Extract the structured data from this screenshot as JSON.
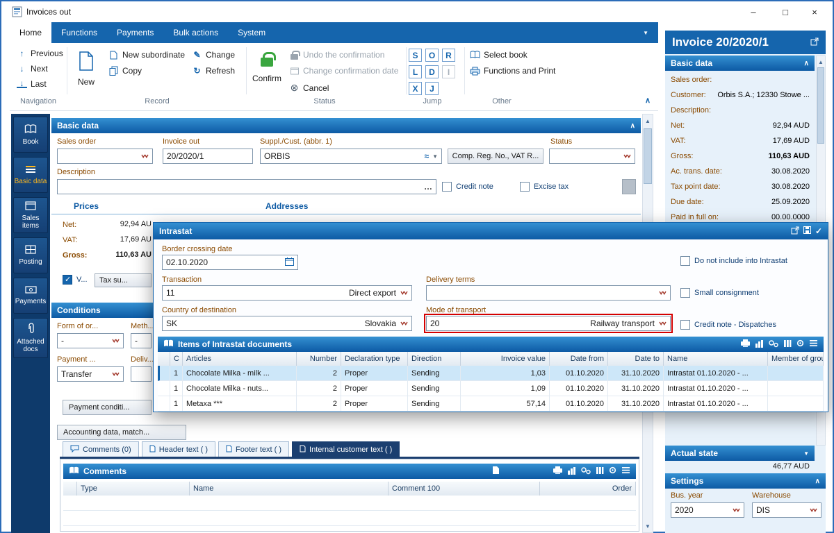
{
  "window": {
    "title": "Invoices out"
  },
  "icons": {
    "minimize": "–",
    "maximize": "□",
    "close": "×",
    "prev": "↑",
    "next": "↓",
    "last": "↓",
    "change": "✎",
    "refresh": "↻",
    "cancel": "⊗",
    "dropdown": "▼",
    "collapse": "∧",
    "check": "✓",
    "dots": "…",
    "supplier": "≈",
    "up": "▲",
    "down": "▼"
  },
  "tabs": [
    {
      "label": "Home"
    },
    {
      "label": "Functions"
    },
    {
      "label": "Payments"
    },
    {
      "label": "Bulk actions"
    },
    {
      "label": "System"
    }
  ],
  "ribbon": {
    "navigation": {
      "label": "Navigation",
      "previous": "Previous",
      "next": "Next",
      "last": "Last"
    },
    "record": {
      "label": "Record",
      "new": "New",
      "new_subordinate": "New subordinate",
      "copy": "Copy",
      "change": "Change",
      "refresh": "Refresh"
    },
    "status": {
      "label": "Status",
      "confirm": "Confirm",
      "undo": "Undo the confirmation",
      "change_date": "Change confirmation date",
      "cancel": "Cancel"
    },
    "jump": {
      "label": "Jump",
      "letters": [
        "S",
        "O",
        "R",
        "L",
        "D",
        "I",
        "X",
        "J"
      ]
    },
    "other": {
      "label": "Other",
      "select_book": "Select book",
      "functions_print": "Functions and Print"
    }
  },
  "sidebar": {
    "items": [
      {
        "label": "Book"
      },
      {
        "label": "Basic data"
      },
      {
        "label": "Sales items"
      },
      {
        "label": "Posting"
      },
      {
        "label": "Payments"
      },
      {
        "label": "Attached docs"
      }
    ]
  },
  "main": {
    "basic": {
      "title": "Basic data",
      "sales_order": "Sales order",
      "invoice_out": "Invoice out",
      "invoice_no": "20/2020/1",
      "supplier": "Suppl./Cust. (abbr. 1)",
      "supplier_value": "ORBIS",
      "comp_reg": "Comp. Reg. No., VAT R...",
      "status": "Status",
      "description": "Description",
      "credit_note": "Credit note",
      "excise_tax": "Excise tax",
      "prices": "Prices",
      "addresses": "Addresses",
      "net": "Net:",
      "net_value": "92,94 AU",
      "vat": "VAT:",
      "vat_value": "17,69 AU",
      "gross": "Gross:",
      "gross_value": "110,63 AU",
      "v_label": "V...",
      "tax_summary": "Tax su..."
    },
    "conditions": {
      "title": "Conditions",
      "form_of": "Form of or...",
      "meth": "Meth...",
      "dash": "-",
      "payment": "Payment ...",
      "deliv": "Deliv...",
      "transfer": "Transfer",
      "payment_conditions": "Payment conditi..."
    },
    "accounting": "Accounting data, match...",
    "tabs": [
      {
        "label": "Comments (0)"
      },
      {
        "label": "Header text ( )"
      },
      {
        "label": "Footer text ( )"
      },
      {
        "label": "Internal customer text ( )"
      }
    ],
    "comments": {
      "title": "Comments",
      "col_type": "Type",
      "col_name": "Name",
      "col_comment": "Comment 100",
      "col_order": "Order"
    }
  },
  "dialog": {
    "title": "Intrastat",
    "border_crossing": "Border crossing date",
    "border_crossing_value": "02.10.2020",
    "transaction": "Transaction",
    "transaction_code": "11",
    "transaction_value": "Direct export",
    "delivery_terms": "Delivery terms",
    "country": "Country of destination",
    "country_code": "SK",
    "country_value": "Slovakia",
    "transport": "Mode of transport",
    "transport_code": "20",
    "transport_value": "Railway transport",
    "cb_no_intrastat": "Do not include into Intrastat",
    "cb_small": "Small consignment",
    "cb_credit": "Credit note - Dispatches",
    "items_title": "Items of Intrastat documents",
    "columns": {
      "c": "C",
      "articles": "Articles",
      "number": "Number",
      "decl": "Declaration type",
      "direction": "Direction",
      "value": "Invoice value",
      "from": "Date from",
      "to": "Date to",
      "name": "Name",
      "member": "Member of grou"
    },
    "rows": [
      {
        "c": "1",
        "articles": "Chocolate Milka - milk ...",
        "number": "2",
        "decl": "Proper",
        "direction": "Sending",
        "value": "1,03",
        "from": "01.10.2020",
        "to": "31.10.2020",
        "name": "Intrastat 01.10.2020 - ..."
      },
      {
        "c": "1",
        "articles": "Chocolate Milka - nuts...",
        "number": "2",
        "decl": "Proper",
        "direction": "Sending",
        "value": "1,09",
        "from": "01.10.2020",
        "to": "31.10.2020",
        "name": "Intrastat 01.10.2020 - ..."
      },
      {
        "c": "1",
        "articles": "Metaxa ***",
        "number": "2",
        "decl": "Proper",
        "direction": "Sending",
        "value": "57,14",
        "from": "01.10.2020",
        "to": "31.10.2020",
        "name": "Intrastat 01.10.2020 - ..."
      }
    ]
  },
  "panel": {
    "title": "Invoice 20/2020/1",
    "basic_title": "Basic data",
    "rows": [
      {
        "label": "Sales order:",
        "value": ""
      },
      {
        "label": "Customer:",
        "value": "Orbis S.A.; 12330 Stowe ..."
      },
      {
        "label": "Description:",
        "value": ""
      },
      {
        "label": "Net:",
        "value": "92,94 AUD"
      },
      {
        "label": "VAT:",
        "value": "17,69 AUD"
      },
      {
        "label": "Gross:",
        "value": "110,63 AUD"
      },
      {
        "label": "Ac. trans. date:",
        "value": "30.08.2020"
      },
      {
        "label": "Tax point date:",
        "value": "30.08.2020"
      },
      {
        "label": "Due date:",
        "value": "25.09.2020"
      },
      {
        "label": "Paid in full on:",
        "value": "00.00.0000"
      }
    ],
    "actual_title": "Actual state",
    "actual_value": "46,77 AUD",
    "settings_title": "Settings",
    "bus_year": "Bus. year",
    "bus_year_value": "2020",
    "warehouse": "Warehouse",
    "warehouse_value": "DIS"
  }
}
